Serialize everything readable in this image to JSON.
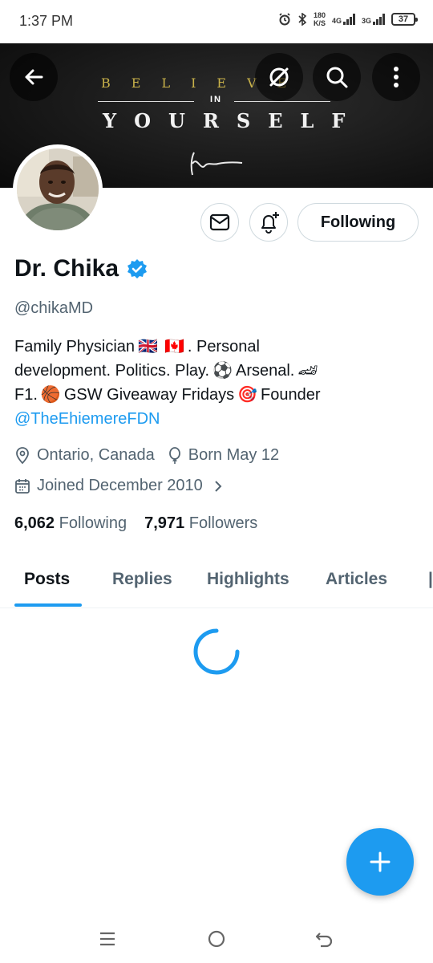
{
  "status_bar": {
    "time": "1:37 PM",
    "net_speed_value": "180",
    "net_speed_unit": "K/S",
    "net1": "4G",
    "net2": "3G",
    "battery": "37"
  },
  "banner": {
    "line1": "BELIEVE",
    "line_in": "IN",
    "line2": "YOURSELF"
  },
  "profile": {
    "display_name": "Dr. Chika",
    "handle": "@chikaMD",
    "following_button_label": "Following",
    "bio_line1_a": "Family Physician",
    "bio_line1_flag1": "🇬🇧",
    "bio_line1_flag2": "🇨🇦",
    "bio_line1_b": ".  Personal",
    "bio_line2_a": "development. Politics. Play.",
    "bio_line2_emoji1": "⚽",
    "bio_line2_b": "Arsenal.",
    "bio_line2_emoji2": "🏎",
    "bio_line3_a": "F1.",
    "bio_line3_emoji1": "🏀",
    "bio_line3_b": "GSW  Giveaway Fridays",
    "bio_line3_emoji2": "🎯",
    "bio_line3_c": "Founder",
    "bio_link": "@TheEhiemereFDN",
    "location": "Ontario, Canada",
    "birthday": "Born May 12",
    "joined": "Joined December 2010",
    "following_count": "6,062",
    "following_label": "Following",
    "followers_count": "7,971",
    "followers_label": "Followers"
  },
  "tabs": [
    {
      "label": "Posts"
    },
    {
      "label": "Replies"
    },
    {
      "label": "Highlights"
    },
    {
      "label": "Articles"
    }
  ],
  "colors": {
    "accent": "#1d9bf0",
    "text_primary": "#0f1419",
    "text_secondary": "#536471"
  }
}
